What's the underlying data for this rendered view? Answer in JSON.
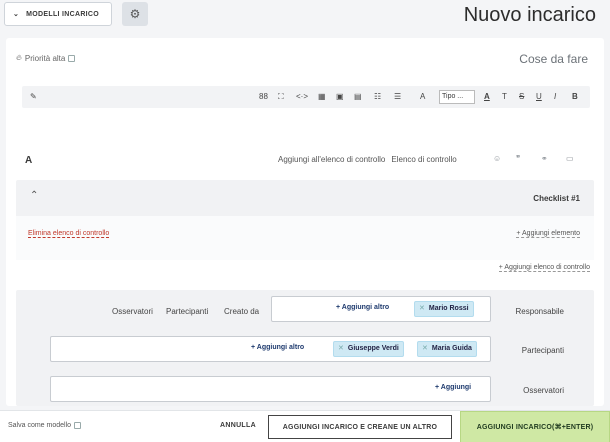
{
  "header": {
    "title": "Nuovo incarico",
    "models_button_label": "MODELLI INCARICO"
  },
  "todo": {
    "section_label": "Cose da fare",
    "priority_label": "Priorità alta"
  },
  "toolbar": {
    "bold": "B",
    "italic": "I",
    "underline": "U",
    "strike": "S",
    "text_size": "T",
    "text_color": "A",
    "type_select": "Tipo ...",
    "highlight": "A",
    "bullets": "☰",
    "numbered": "☷",
    "image": "▣",
    "embed": "▤",
    "table": "▦",
    "code": "<·>",
    "expand": "⛶",
    "html": "88",
    "clear": "✎"
  },
  "checklist_bar": {
    "font_size_label": "A",
    "add_to_checklist": "Aggiungi all'elenco di controllo",
    "checklist": "Elenco di controllo"
  },
  "checklist": {
    "title": "Checklist #1",
    "add_item": "+ Aggiungi elemento",
    "delete": "Elimina elenco di controllo",
    "add_checklist": "+ Aggiungi elenco di controllo"
  },
  "people": {
    "tabs": [
      "Creato da",
      "Partecipanti",
      "Osservatori"
    ],
    "responsible_label": "Responsabile",
    "responsible_chips": [
      "Mario Rossi"
    ],
    "participants_label": "Partecipanti",
    "participants_chips": [
      "Maria Guida",
      "Giuseppe Verdi"
    ],
    "observers_label": "Osservatori",
    "add_other": "+ Aggiungi altro",
    "add": "+ Aggiungi"
  },
  "footer": {
    "primary": "AGGIUNGI INCARICO(⌘+ENTER)",
    "secondary": "AGGIUNGI INCARICO E CREANE UN ALTRO",
    "cancel": "ANNULLA",
    "save_model": "Salva come modello"
  },
  "colors": {
    "primary_button": "#cfe8a4",
    "chip": "#cfe9f4",
    "delete_link": "#c0392b"
  }
}
